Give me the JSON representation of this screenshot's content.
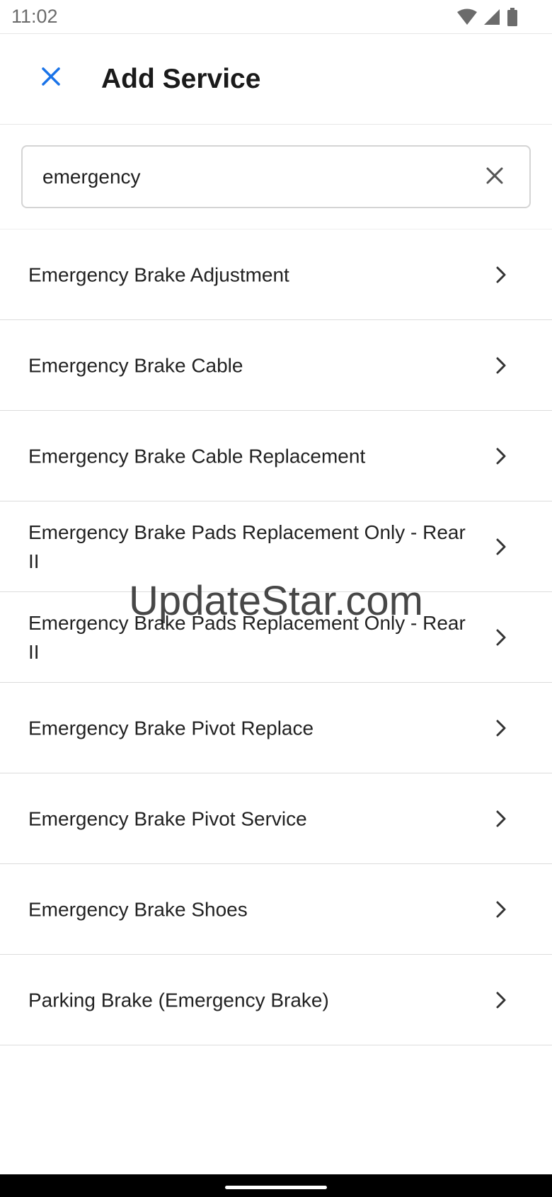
{
  "status_bar": {
    "time": "11:02",
    "icons": [
      "wifi-icon",
      "cellular-signal-icon",
      "battery-icon"
    ]
  },
  "header": {
    "title": "Add Service",
    "close_icon": "close-icon"
  },
  "search": {
    "value": "emergency",
    "placeholder": "",
    "clear_icon": "clear-icon"
  },
  "results": [
    {
      "label": "Emergency Brake Adjustment"
    },
    {
      "label": "Emergency Brake Cable"
    },
    {
      "label": "Emergency Brake Cable Replacement"
    },
    {
      "label": "Emergency Brake Pads Replacement Only - Rear II"
    },
    {
      "label": "Emergency Brake Pads Replacement Only - Rear II"
    },
    {
      "label": "Emergency Brake Pivot Replace"
    },
    {
      "label": "Emergency Brake Pivot Service"
    },
    {
      "label": "Emergency Brake Shoes"
    },
    {
      "label": "Parking Brake (Emergency Brake)"
    }
  ],
  "watermark": "UpdateStar.com",
  "colors": {
    "accent": "#1a73e8",
    "text": "#222222",
    "divider": "#dcdcdc"
  }
}
